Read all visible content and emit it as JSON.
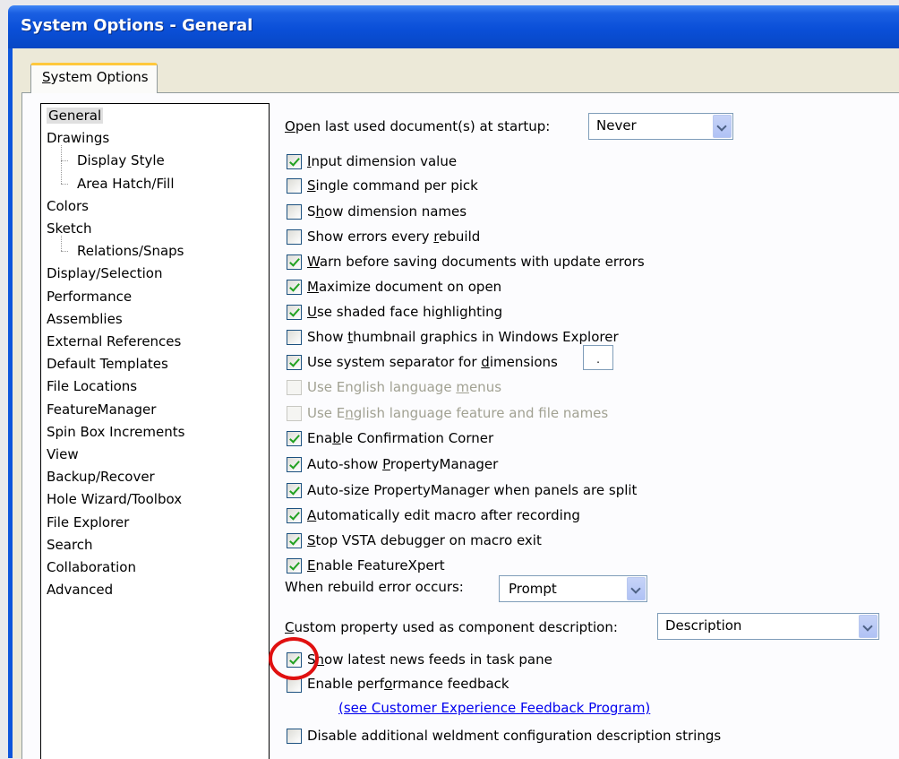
{
  "window": {
    "title": "System Options - General"
  },
  "tabs": [
    {
      "label": "System Options",
      "accel": "S",
      "rest": "ystem Options"
    }
  ],
  "tree": {
    "items": [
      {
        "label": "General",
        "level": 0,
        "selected": true
      },
      {
        "label": "Drawings",
        "level": 0
      },
      {
        "label": "Display Style",
        "level": 1
      },
      {
        "label": "Area Hatch/Fill",
        "level": 1
      },
      {
        "label": "Colors",
        "level": 0
      },
      {
        "label": "Sketch",
        "level": 0
      },
      {
        "label": "Relations/Snaps",
        "level": 1
      },
      {
        "label": "Display/Selection",
        "level": 0
      },
      {
        "label": "Performance",
        "level": 0
      },
      {
        "label": "Assemblies",
        "level": 0
      },
      {
        "label": "External References",
        "level": 0
      },
      {
        "label": "Default Templates",
        "level": 0
      },
      {
        "label": "File Locations",
        "level": 0
      },
      {
        "label": "FeatureManager",
        "level": 0
      },
      {
        "label": "Spin Box Increments",
        "level": 0
      },
      {
        "label": "View",
        "level": 0
      },
      {
        "label": "Backup/Recover",
        "level": 0
      },
      {
        "label": "Hole Wizard/Toolbox",
        "level": 0
      },
      {
        "label": "File Explorer",
        "level": 0
      },
      {
        "label": "Search",
        "level": 0
      },
      {
        "label": "Collaboration",
        "level": 0
      },
      {
        "label": "Advanced",
        "level": 0
      }
    ]
  },
  "open_last": {
    "pre": "",
    "accel": "O",
    "post": "pen last used document(s) at startup:",
    "value": "Never"
  },
  "checkboxes": [
    {
      "pre": "",
      "accel": "I",
      "post": "nput dimension value",
      "checked": true,
      "enabled": true
    },
    {
      "pre": "",
      "accel": "S",
      "post": "ingle command per pick",
      "checked": false,
      "enabled": true
    },
    {
      "pre": "S",
      "accel": "h",
      "post": "ow dimension names",
      "checked": false,
      "enabled": true
    },
    {
      "pre": "Show errors every ",
      "accel": "r",
      "post": "ebuild",
      "checked": false,
      "enabled": true
    },
    {
      "pre": "",
      "accel": "W",
      "post": "arn before saving documents with update errors",
      "checked": true,
      "enabled": true
    },
    {
      "pre": "",
      "accel": "M",
      "post": "aximize document on open",
      "checked": true,
      "enabled": true
    },
    {
      "pre": "",
      "accel": "U",
      "post": "se shaded face highlighting",
      "checked": true,
      "enabled": true
    },
    {
      "pre": "Show ",
      "accel": "t",
      "post": "humbnail graphics in Windows Explorer",
      "checked": false,
      "enabled": true
    },
    {
      "pre": "Use system separator for ",
      "accel": "d",
      "post": "imensions",
      "checked": true,
      "enabled": true
    },
    {
      "pre": "Use English language ",
      "accel": "m",
      "post": "enus",
      "checked": false,
      "enabled": false
    },
    {
      "pre": "Use E",
      "accel": "n",
      "post": "glish language feature and file names",
      "checked": false,
      "enabled": false
    },
    {
      "pre": "Ena",
      "accel": "b",
      "post": "le Confirmation Corner",
      "checked": true,
      "enabled": true
    },
    {
      "pre": "Auto-show ",
      "accel": "P",
      "post": "ropertyManager",
      "checked": true,
      "enabled": true
    },
    {
      "pre": "Auto-size PropertyMana",
      "accel": "g",
      "post": "er when panels are split",
      "checked": true,
      "enabled": true
    },
    {
      "pre": "",
      "accel": "A",
      "post": "utomatically edit macro after recording",
      "checked": true,
      "enabled": true
    },
    {
      "pre": "",
      "accel": "S",
      "post": "top VSTA debugger on macro exit",
      "checked": true,
      "enabled": true
    },
    {
      "pre": "",
      "accel": "E",
      "post": "nable FeatureXpert",
      "checked": true,
      "enabled": true
    }
  ],
  "separator_value": ".",
  "rebuild_error": {
    "label": "When rebuild error occurs:",
    "value": "Prompt"
  },
  "custom_property": {
    "pre": "",
    "accel": "C",
    "post": "ustom property used as component description:",
    "value": "Description"
  },
  "bottom_checkboxes": [
    {
      "pre": "S",
      "accel": "h",
      "post": "ow latest news feeds in task pane",
      "checked": true
    },
    {
      "pre": "Enable perf",
      "accel": "o",
      "post": "rmance feedback",
      "checked": false
    }
  ],
  "feedback_link": "(see Customer Experience Feedback Program)",
  "disable_weldment": {
    "pre": "Disable additional weldment configuration description strin",
    "accel": "g",
    "post": "s",
    "checked": false
  },
  "colors": {
    "title_bar": "#0a4fd8",
    "highlight_circle": "#e01010",
    "check": "#21a121",
    "link": "#0000ee"
  }
}
